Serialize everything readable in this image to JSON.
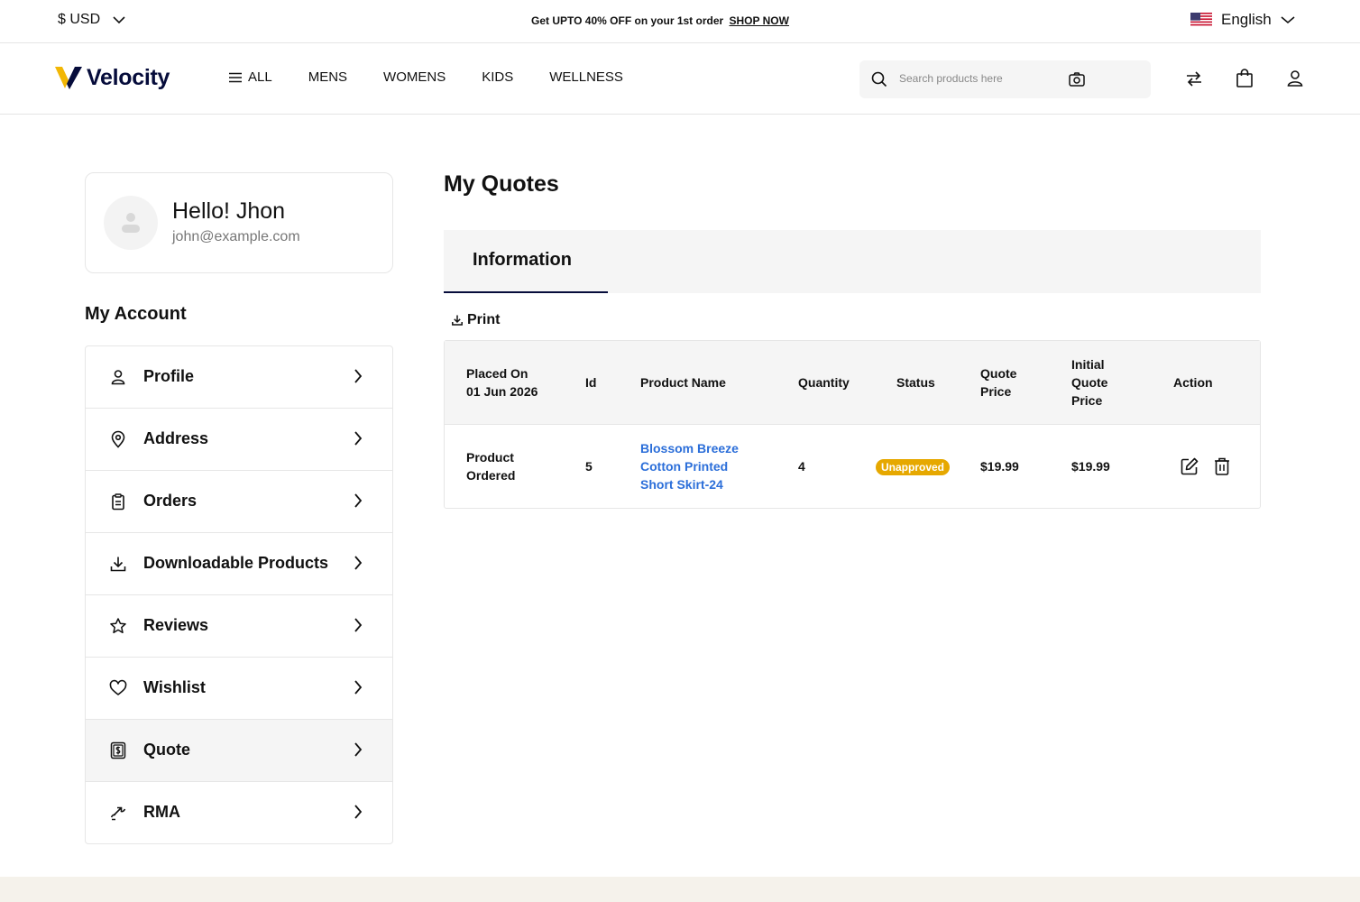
{
  "topbar": {
    "currency": "$ USD",
    "promo_text": "Get UPTO 40% OFF on your 1st order",
    "promo_link": "SHOP NOW",
    "language": "English"
  },
  "header": {
    "logo_text": "Velocity",
    "nav": [
      "ALL",
      "MENS",
      "WOMENS",
      "KIDS",
      "WELLNESS"
    ],
    "search_placeholder": "Search products here"
  },
  "account": {
    "greeting": "Hello! Jhon",
    "email": "john@example.com",
    "section_title": "My Account",
    "menu": [
      {
        "label": "Profile",
        "icon": "user-icon"
      },
      {
        "label": "Address",
        "icon": "location-pin-icon"
      },
      {
        "label": "Orders",
        "icon": "clipboard-icon"
      },
      {
        "label": "Downloadable Products",
        "icon": "download-icon"
      },
      {
        "label": "Reviews",
        "icon": "star-icon"
      },
      {
        "label": "Wishlist",
        "icon": "heart-icon"
      },
      {
        "label": "Quote",
        "icon": "quote-icon",
        "active": true
      },
      {
        "label": "RMA",
        "icon": "exchange-icon"
      }
    ]
  },
  "main": {
    "title": "My Quotes",
    "tab": "Information",
    "print": "Print",
    "table": {
      "headers": {
        "placed_on_label": "Placed On",
        "placed_on_date": "01 Jun 2026",
        "id": "Id",
        "product_name": "Product Name",
        "quantity": "Quantity",
        "status": "Status",
        "quote_price_1": "Quote",
        "quote_price_2": "Price",
        "initial_1": "Initial",
        "initial_2": "Quote",
        "initial_3": "Price",
        "action": "Action"
      },
      "row": {
        "label_1": "Product",
        "label_2": "Ordered",
        "id": "5",
        "product_1": "Blossom Breeze",
        "product_2": "Cotton Printed",
        "product_3": "Short Skirt-24",
        "quantity": "4",
        "status": "Unapproved",
        "quote_price": "$19.99",
        "initial_quote_price": "$19.99"
      }
    }
  },
  "colors": {
    "brand_navy": "#060c3b",
    "logo_yellow": "#f2b705",
    "link_blue": "#2b6ed9",
    "badge_amber": "#e6a800"
  }
}
